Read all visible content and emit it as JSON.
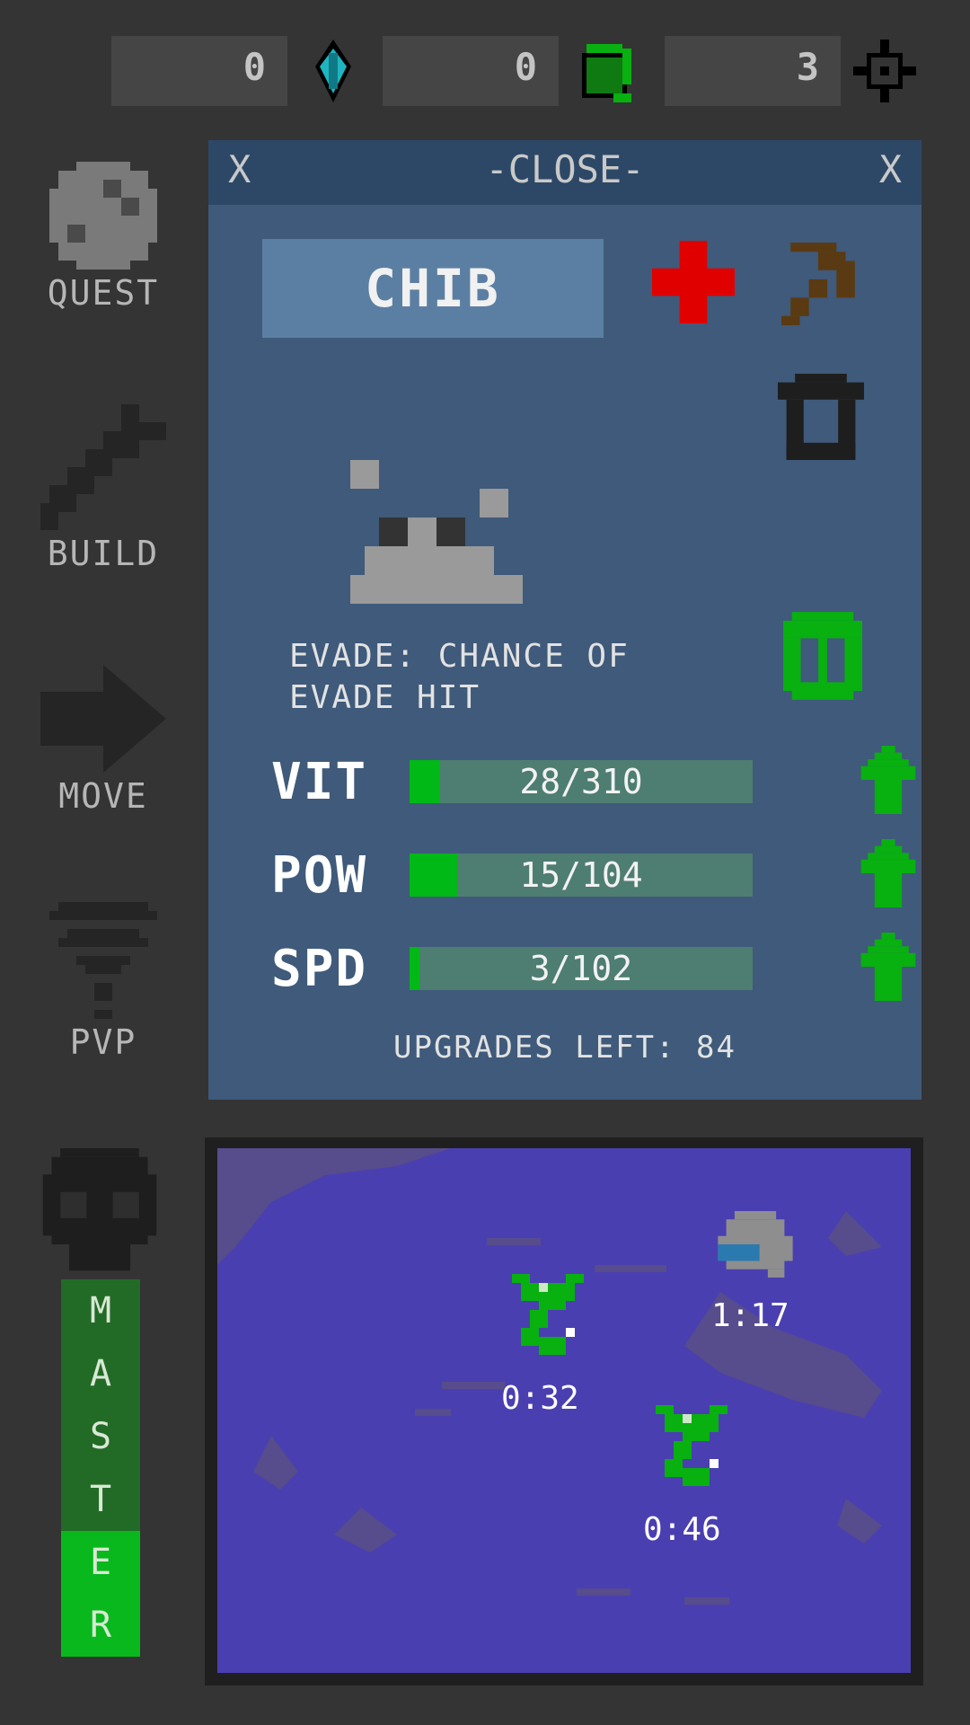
{
  "resources": [
    {
      "value": "0",
      "icon": "crystal-icon"
    },
    {
      "value": "0",
      "icon": "green-jar-icon"
    },
    {
      "value": "3",
      "icon": "crosshair-icon"
    }
  ],
  "sidebar": {
    "items": [
      {
        "label": "QUEST",
        "icon": "moon-icon"
      },
      {
        "label": "BUILD",
        "icon": "wrench-icon"
      },
      {
        "label": "MOVE",
        "icon": "arrow-right-icon"
      },
      {
        "label": "PVP",
        "icon": "wifi-icon"
      }
    ],
    "master": {
      "letters": [
        "M",
        "A",
        "S",
        "T",
        "E",
        "R"
      ],
      "filled": 2
    }
  },
  "panel": {
    "close_left": "X",
    "close_label": "-CLOSE-",
    "close_right": "X",
    "name": "CHIB",
    "description_line1": "EVADE: CHANCE OF",
    "description_line2": "EVADE HIT",
    "stats": [
      {
        "label": "VIT",
        "value": "28/310",
        "fill": 0.09
      },
      {
        "label": "POW",
        "value": "15/104",
        "fill": 0.14
      },
      {
        "label": "SPD",
        "value": "3/102",
        "fill": 0.03
      }
    ],
    "upgrades_left": "UPGRADES LEFT: 84"
  },
  "map": {
    "timers": [
      "1:17",
      "0:32",
      "0:46"
    ]
  },
  "colors": {
    "background": "#343434",
    "panel": "#3f5a7a",
    "panel_header": "#2c4866",
    "bar_fill": "#00b816",
    "bar_bg": "#4e7d72",
    "map": "#4a3fb0",
    "heal": "#e00000",
    "pickaxe": "#5a3a12"
  }
}
